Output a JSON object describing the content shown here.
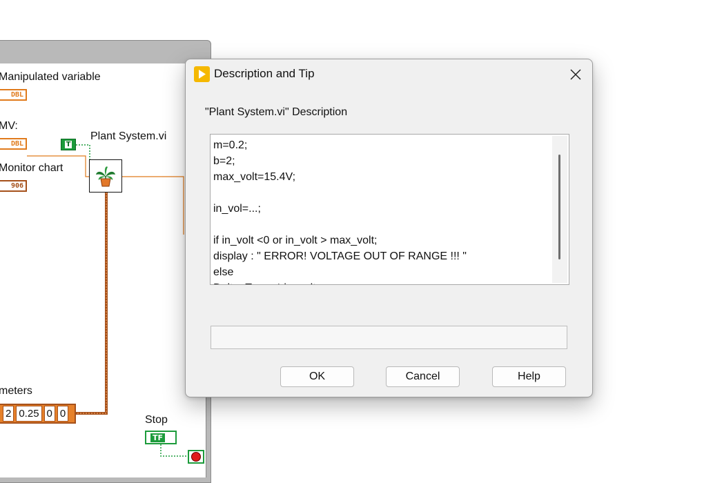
{
  "block_diagram": {
    "labels": {
      "manipulated_variable": "Manipulated variable",
      "mv": "MV:",
      "monitor_chart": "Monitor chart",
      "plant_system": "Plant System.vi",
      "parameters": "meters",
      "stop": "Stop"
    },
    "terminals": {
      "dbl_1": "DBL",
      "dbl_2": "DBL",
      "chart_icon": "906",
      "bool_constant": "T",
      "stop_term": "TF"
    },
    "cluster_values": [
      "2",
      "0.25",
      "0",
      "0"
    ],
    "colors": {
      "double_wire": "#e07a1b",
      "cluster_wire": "#a5501a",
      "boolean_wire": "#1c9b3b"
    }
  },
  "dialog": {
    "title": "Description and Tip",
    "app_icon": "labview-run-arrow-icon",
    "close_icon": "close-icon",
    "description_label": "\"Plant System.vi\" Description",
    "description_text": "m=0.2;\nb=2;\nmax_volt=15.4V;\n\nin_vol=...;\n\nif in_volt <0 or in_volt > max_volt;\ndisplay : \" ERROR! VOLTAGE OUT OF RANGE !!! \"\nelse\nDelta_T = ... * in_volt ...",
    "tip_value": "",
    "buttons": {
      "ok": "OK",
      "cancel": "Cancel",
      "help": "Help"
    }
  }
}
